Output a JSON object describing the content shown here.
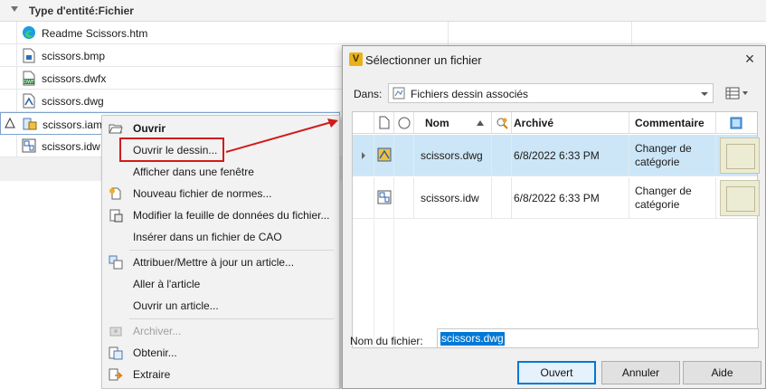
{
  "filelist": {
    "group_label": "Type d'entité:Fichier",
    "files": [
      {
        "name": "Readme Scissors.htm",
        "icon": "edge-html-icon"
      },
      {
        "name": "scissors.bmp",
        "icon": "bitmap-file-icon"
      },
      {
        "name": "scissors.dwfx",
        "icon": "dwf-file-icon"
      },
      {
        "name": "scissors.dwg",
        "icon": "dwg-file-icon"
      },
      {
        "name": "scissors.iam",
        "icon": "assembly-file-icon"
      },
      {
        "name": "scissors.idw",
        "icon": "idw-file-icon"
      }
    ]
  },
  "context_menu": {
    "items": [
      {
        "label": "Ouvrir",
        "icon": "open-folder-icon",
        "bold": true
      },
      {
        "label": "Ouvrir le dessin...",
        "icon": "",
        "bold": false
      },
      {
        "label": "Afficher dans une fenêtre",
        "icon": "",
        "bold": false
      },
      {
        "label": "Nouveau fichier de normes...",
        "icon": "new-standards-icon",
        "bold": false
      },
      {
        "label": "Modifier la feuille de données du fichier...",
        "icon": "datasheet-icon",
        "bold": false
      },
      {
        "label": "Insérer dans un fichier de CAO",
        "icon": "",
        "bold": false
      },
      {
        "label": "Attribuer/Mettre à jour un article...",
        "icon": "assign-item-icon",
        "bold": false
      },
      {
        "label": "Aller à l'article",
        "icon": "",
        "bold": false
      },
      {
        "label": "Ouvrir un article...",
        "icon": "",
        "bold": false
      },
      {
        "label": "Archiver...",
        "icon": "check-in-icon",
        "disabled": true
      },
      {
        "label": "Obtenir...",
        "icon": "get-icon",
        "bold": false
      },
      {
        "label": "Extraire",
        "icon": "check-out-icon",
        "bold": false
      }
    ]
  },
  "dialog": {
    "title": "Sélectionner un fichier",
    "dans_label": "Dans:",
    "dans_value": "Fichiers dessin associés",
    "columns": {
      "nom": "Nom",
      "archive": "Archivé",
      "commentaire": "Commentaire"
    },
    "rows": [
      {
        "name": "scissors.dwg",
        "archived": "6/8/2022 6:33 PM",
        "comment": "Changer de catégorie",
        "selected": true
      },
      {
        "name": "scissors.idw",
        "archived": "6/8/2022 6:33 PM",
        "comment": "Changer de catégorie",
        "selected": false
      }
    ],
    "filename_label": "Nom du fichier:",
    "filename_value": "scissors.dwg",
    "buttons": {
      "ok": "Ouvert",
      "cancel": "Annuler",
      "help": "Aide"
    }
  },
  "colors": {
    "selection_blue": "#0078d7",
    "row_selected": "#cce6f7",
    "highlight_red": "#d21b1b"
  }
}
